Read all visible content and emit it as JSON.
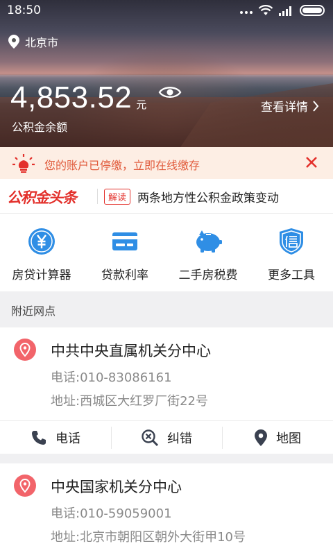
{
  "status_bar": {
    "time": "18:50"
  },
  "hero": {
    "city": "北京市",
    "balance": "4,853.52",
    "unit": "元",
    "balance_label": "公积金余额",
    "details_link": "查看详情"
  },
  "notice": {
    "text": "您的账户已停缴，立即在线缴存"
  },
  "headline": {
    "brand": "公积金头条",
    "tag": "解读",
    "title": "两条地方性公积金政策变动"
  },
  "tools": [
    {
      "label": "房贷计算器",
      "icon": "yuan-coin-icon"
    },
    {
      "label": "贷款利率",
      "icon": "card-icon"
    },
    {
      "label": "二手房税费",
      "icon": "piggy-bank-icon"
    },
    {
      "label": "更多工具",
      "icon": "shield-xin-icon"
    }
  ],
  "section": {
    "title": "附近网点"
  },
  "branches": [
    {
      "name": "中共中央直属机关分中心",
      "phone": "电话:010-83086161",
      "address": "地址:西城区大红罗厂街22号"
    },
    {
      "name": "中央国家机关分中心",
      "phone": "电话:010-59059001",
      "address": "地址:北京市朝阳区朝外大街甲10号"
    }
  ],
  "branch_actions": {
    "call": "电话",
    "correct": "纠错",
    "map": "地图"
  },
  "colors": {
    "accent_red": "#e3302b",
    "notice_text": "#e15b3c",
    "icon_blue": "#2f8ee5",
    "notice_bg": "#fdeee4"
  }
}
